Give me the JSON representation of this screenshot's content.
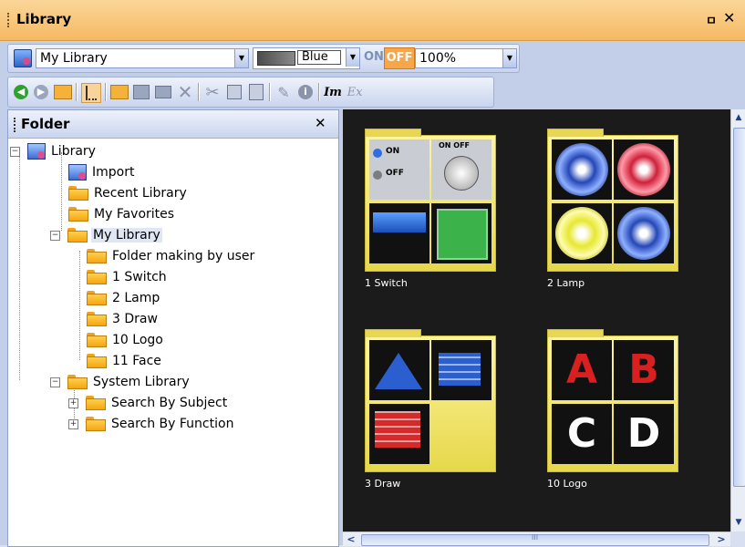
{
  "window": {
    "title": "Library",
    "pin_icon": "pin-icon",
    "close_glyph": "✕"
  },
  "toolbar1": {
    "library_select": "My Library",
    "color_select": "Blue",
    "on_label": "ON",
    "off_label": "OFF",
    "zoom_select": "100%"
  },
  "toolbar2": {
    "icons": [
      "back-icon",
      "forward-icon",
      "up-folder-icon",
      "tree-view-icon",
      "new-folder-icon",
      "import-icon",
      "export-icon",
      "delete-icon",
      "cut-icon",
      "copy-icon",
      "paste-icon",
      "edit-icon",
      "info-icon",
      "rename-icon",
      "ex-icon"
    ],
    "rename_label": "Im",
    "ex_label": "Ex"
  },
  "folder_pane": {
    "title": "Folder",
    "close_glyph": "✕",
    "tree": {
      "root": "Library",
      "import": "Import",
      "recent": "Recent Library",
      "favorites": "My Favorites",
      "my_library": "My Library",
      "my_children": [
        "Folder making by user",
        "1 Switch",
        "2 Lamp",
        "3 Draw",
        "10 Logo",
        "11 Face"
      ],
      "system": "System Library",
      "system_children": [
        "Search By Subject",
        "Search By Function"
      ]
    }
  },
  "gallery": {
    "items": [
      "1 Switch",
      "2 Lamp",
      "3 Draw",
      "10 Logo"
    ],
    "switch_on": "ON",
    "switch_off": "OFF",
    "switch_onoff": "ON OFF",
    "logo_letters": [
      "A",
      "B",
      "C",
      "D"
    ],
    "scroll_grip": "III"
  },
  "colors": {
    "titlebar": "#f5b963",
    "accent": "#f7a64a",
    "gallery_bg": "#1b1b1b"
  }
}
